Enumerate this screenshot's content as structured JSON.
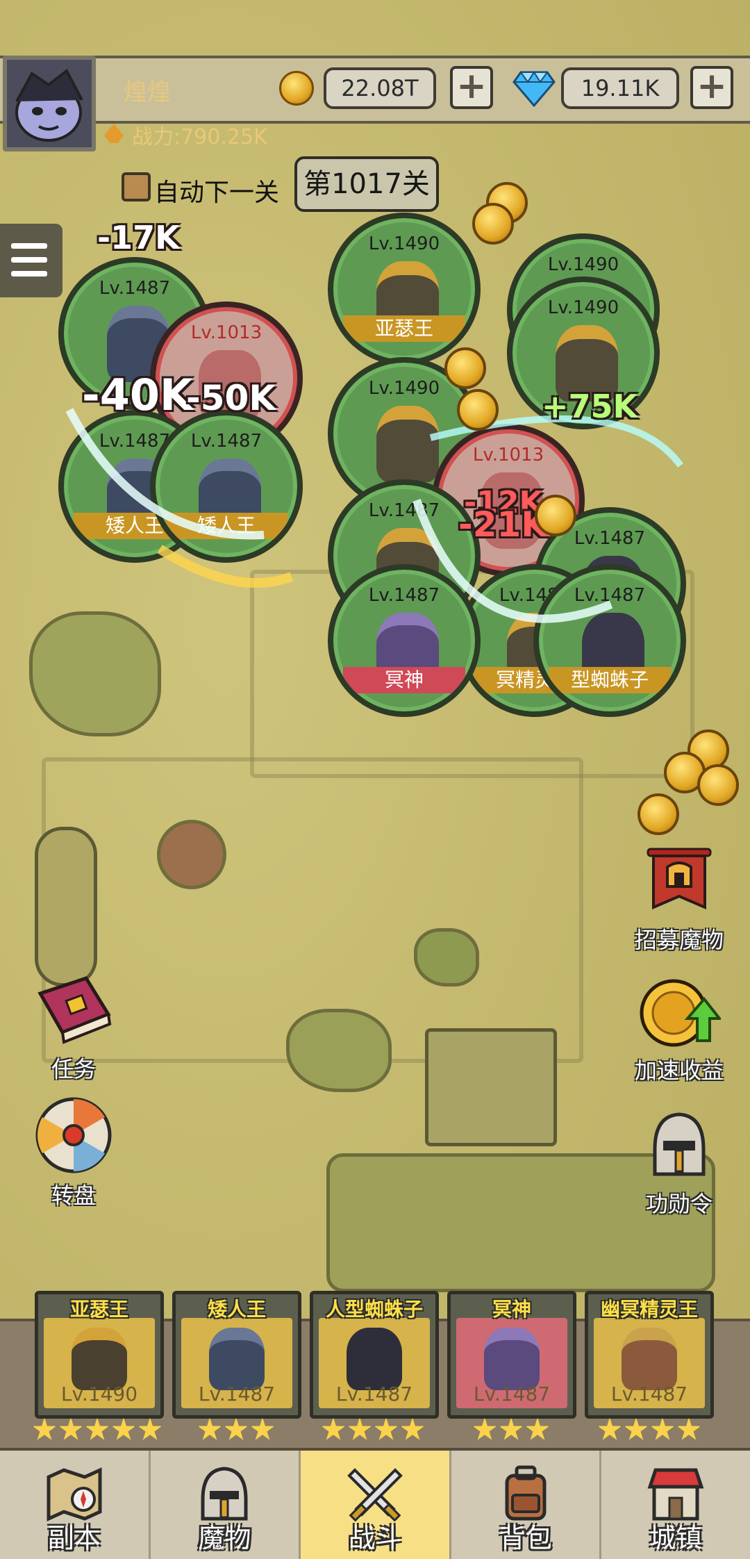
{
  "player": {
    "name": "煌煌",
    "power": "战力:790.25K"
  },
  "resources": {
    "gold": "22.08T",
    "gems": "19.11K",
    "plus": "+"
  },
  "stage": {
    "auto_next_label": "自动下一关",
    "current": "第1017关"
  },
  "battle": {
    "units": [
      {
        "lv": "Lv.1490",
        "name": "亚瑟王",
        "side": "ally"
      },
      {
        "lv": "Lv.1490",
        "name": "",
        "side": "ally"
      },
      {
        "lv": "Lv.1490",
        "name": "",
        "side": "ally"
      },
      {
        "lv": "Lv.1487",
        "name": "",
        "side": "ally"
      },
      {
        "lv": "Lv.1013",
        "name": "",
        "side": "enemy"
      },
      {
        "lv": "Lv.1487",
        "name": "矮人王",
        "side": "ally"
      },
      {
        "lv": "Lv.1487",
        "name": "矮人王",
        "side": "ally"
      },
      {
        "lv": "Lv.1490",
        "name": "",
        "side": "ally"
      },
      {
        "lv": "Lv.1013",
        "name": "",
        "side": "enemy"
      },
      {
        "lv": "Lv.1487",
        "name": "",
        "side": "ally"
      },
      {
        "lv": "Lv.1487",
        "name": "冥神",
        "side": "ally"
      },
      {
        "lv": "Lv.1487",
        "name": "冥精灵王",
        "side": "ally"
      },
      {
        "lv": "Lv.1487",
        "name": "型蜘蛛子",
        "side": "ally"
      },
      {
        "lv": "Lv.1487",
        "name": "",
        "side": "ally"
      }
    ],
    "damage": [
      "-17K",
      "-40K",
      "-50K",
      "+75K",
      "-12K",
      "-21K"
    ]
  },
  "side_buttons": {
    "recruit": "招募魔物",
    "speedup": "加速收益",
    "merit": "功勋令",
    "quest": "任务",
    "wheel": "转盘"
  },
  "heroes": [
    {
      "name": "亚瑟王",
      "lv": "Lv.1490",
      "stars": 5
    },
    {
      "name": "矮人王",
      "lv": "Lv.1487",
      "stars": 3
    },
    {
      "name": "人型蜘蛛子",
      "lv": "Lv.1487",
      "stars": 4
    },
    {
      "name": "冥神",
      "lv": "Lv.1487",
      "stars": 3
    },
    {
      "name": "幽冥精灵王",
      "lv": "Lv.1487",
      "stars": 4
    }
  ],
  "nav": [
    {
      "label": "副本",
      "icon": "map-icon"
    },
    {
      "label": "魔物",
      "icon": "helmet-icon"
    },
    {
      "label": "战斗",
      "icon": "crossed-swords-icon",
      "active": true
    },
    {
      "label": "背包",
      "icon": "backpack-icon"
    },
    {
      "label": "城镇",
      "icon": "shop-icon"
    }
  ],
  "colors": {
    "map": "#c4b96e",
    "ally": "#5f9a53",
    "enemy": "#caa096",
    "active_tab": "#f7df86"
  }
}
